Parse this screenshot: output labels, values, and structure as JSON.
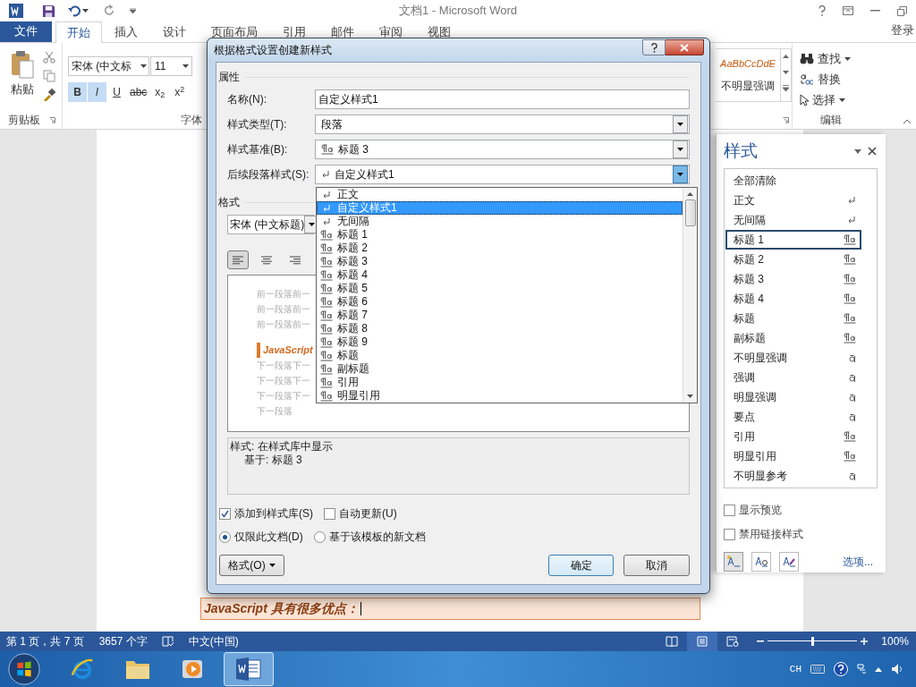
{
  "window": {
    "title": "文档1 - Microsoft Word"
  },
  "ribbon_tabs": {
    "file": "文件",
    "sign_in": "登录",
    "tabs": [
      {
        "label": "开始",
        "selected": true
      },
      {
        "label": "插入",
        "selected": false
      },
      {
        "label": "设计",
        "selected": false
      },
      {
        "label": "页面布局",
        "selected": false
      },
      {
        "label": "引用",
        "selected": false
      },
      {
        "label": "邮件",
        "selected": false
      },
      {
        "label": "审阅",
        "selected": false
      },
      {
        "label": "视图",
        "selected": false
      }
    ]
  },
  "ribbon": {
    "paste": "粘贴",
    "clipboard_label": "剪贴板",
    "font_name": "宋体 (中文标",
    "font_size": "11",
    "font_label": "字体",
    "font_buttons": [
      {
        "label": "B",
        "selected": true
      },
      {
        "label": "I",
        "selected": true
      },
      {
        "label": "U",
        "selected": false
      },
      {
        "label": "abc",
        "selected": false
      },
      {
        "label": "x$_{2}$",
        "selected": false
      },
      {
        "label": "x$^{2}$",
        "selected": false
      }
    ],
    "gallery_sample": "AaBbCcDdE",
    "gallery_style": "不明显强调",
    "editing": [
      {
        "kind": "find",
        "label": "查找"
      },
      {
        "kind": "replace",
        "label": "替换"
      },
      {
        "kind": "select",
        "label": "选择"
      }
    ],
    "editing_label": "编辑"
  },
  "document": {
    "text_line": "JavaScript 具有很多优点："
  },
  "dialog": {
    "title": "根据格式设置创建新样式",
    "properties_label": "属性",
    "fields": [
      {
        "label": "名称(N):",
        "value": "自定义样式1",
        "dropdown": false
      },
      {
        "label": "样式类型(T):",
        "value": "段落",
        "dropdown": true
      },
      {
        "label": "样式基准(B):",
        "value": "标题 3",
        "dropdown": true,
        "kind": "linked"
      },
      {
        "label": "后续段落样式(S):",
        "value": "自定义样式1",
        "dropdown": true,
        "kind": "para",
        "expanded": true
      }
    ],
    "format_label": "格式",
    "font_value": "宋体 (中文标题)",
    "align_buttons": [
      {
        "kind": "left",
        "selected": true
      },
      {
        "kind": "center",
        "selected": false
      },
      {
        "kind": "right",
        "selected": false
      }
    ],
    "preview_before": [
      "前一段落前一",
      "前一段落前一",
      "前一段落前一"
    ],
    "preview_sample": "JavaScript",
    "preview_after": [
      "下一段落下一",
      "下一段落下一",
      "下一段落下一",
      "下一段落"
    ],
    "description": [
      "样式: 在样式库中显示",
      "基于: 标题 3"
    ],
    "checkboxes": [
      {
        "label": "添加到样式库(S)",
        "checked": true
      },
      {
        "label": "自动更新(U)",
        "checked": false
      }
    ],
    "radios": [
      {
        "label": "仅限此文档(D)",
        "selected": true
      },
      {
        "label": "基于该模板的新文档",
        "selected": false
      }
    ],
    "format_button": "格式(O)",
    "ok": "确定",
    "cancel": "取消",
    "dropdown": [
      {
        "label": "正文",
        "kind": "para",
        "selected": false
      },
      {
        "label": "自定义样式1",
        "kind": "para",
        "selected": true
      },
      {
        "label": "无间隔",
        "kind": "para",
        "selected": false
      },
      {
        "label": "标题 1",
        "kind": "linked",
        "selected": false
      },
      {
        "label": "标题 2",
        "kind": "linked",
        "selected": false
      },
      {
        "label": "标题 3",
        "kind": "linked",
        "selected": false
      },
      {
        "label": "标题 4",
        "kind": "linked",
        "selected": false
      },
      {
        "label": "标题 5",
        "kind": "linked",
        "selected": false
      },
      {
        "label": "标题 6",
        "kind": "linked",
        "selected": false
      },
      {
        "label": "标题 7",
        "kind": "linked",
        "selected": false
      },
      {
        "label": "标题 8",
        "kind": "linked",
        "selected": false
      },
      {
        "label": "标题 9",
        "kind": "linked",
        "selected": false
      },
      {
        "label": "标题",
        "kind": "linked",
        "selected": false
      },
      {
        "label": "副标题",
        "kind": "linked",
        "selected": false
      },
      {
        "label": "引用",
        "kind": "linked",
        "selected": false
      },
      {
        "label": "明显引用",
        "kind": "linked",
        "selected": false
      }
    ]
  },
  "styles_pane": {
    "title": "样式",
    "items": [
      {
        "label": "全部清除",
        "kind": "none",
        "selected": false
      },
      {
        "label": "正文",
        "kind": "para",
        "selected": false
      },
      {
        "label": "无间隔",
        "kind": "para",
        "selected": false
      },
      {
        "label": "标题 1",
        "kind": "linked",
        "selected": true
      },
      {
        "label": "标题 2",
        "kind": "linked",
        "selected": false
      },
      {
        "label": "标题 3",
        "kind": "linked",
        "selected": false
      },
      {
        "label": "标题 4",
        "kind": "linked",
        "selected": false
      },
      {
        "label": "标题",
        "kind": "linked",
        "selected": false
      },
      {
        "label": "副标题",
        "kind": "linked",
        "selected": false
      },
      {
        "label": "不明显强调",
        "kind": "char",
        "selected": false
      },
      {
        "label": "强调",
        "kind": "char",
        "selected": false
      },
      {
        "label": "明显强调",
        "kind": "char",
        "selected": false
      },
      {
        "label": "要点",
        "kind": "char",
        "selected": false
      },
      {
        "label": "引用",
        "kind": "linked",
        "selected": false
      },
      {
        "label": "明显引用",
        "kind": "linked",
        "selected": false
      },
      {
        "label": "不明显参考",
        "kind": "char",
        "selected": false
      }
    ],
    "options": [
      {
        "label": "显示预览",
        "checked": false
      },
      {
        "label": "禁用链接样式",
        "checked": false
      }
    ],
    "link": "选项..."
  },
  "status_bar": {
    "page": "第 1 页，共 7 页",
    "words": "3657 个字",
    "language": "中文(中国)",
    "zoom": "100%",
    "zoom_slider": {
      "level": 0.5
    },
    "views": [
      {
        "kind": "read",
        "selected": false
      },
      {
        "kind": "print",
        "selected": true
      },
      {
        "kind": "web",
        "selected": false
      }
    ]
  },
  "taskbar": {
    "language": "CH",
    "apps": [
      {
        "kind": "ie",
        "selected": false
      },
      {
        "kind": "explorer",
        "selected": false
      },
      {
        "kind": "media",
        "selected": false
      },
      {
        "kind": "word",
        "selected": true
      }
    ]
  }
}
